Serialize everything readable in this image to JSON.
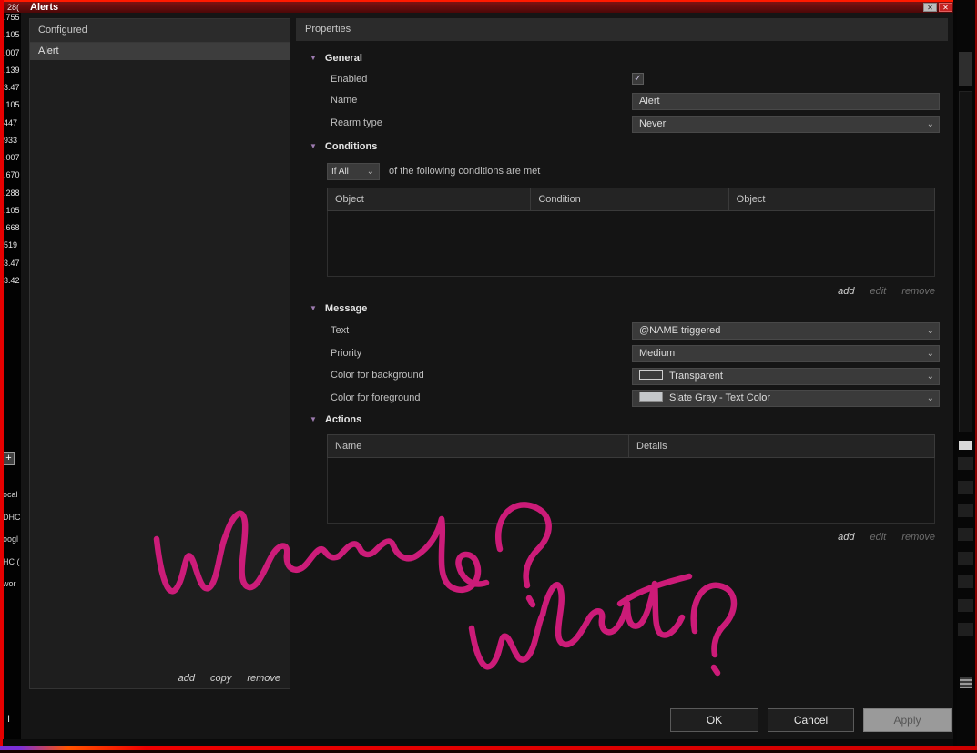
{
  "window": {
    "title": "Alerts",
    "titlebar_prefix": "28("
  },
  "icons": {
    "close": "✕",
    "check": "✓",
    "chevron_down": "⌄",
    "section_arrow": "▼",
    "plus": "+",
    "cursor": "I"
  },
  "left_axis": {
    "values": [
      ".755",
      ".105",
      ".007",
      ".139",
      "3.47",
      ".105",
      "447",
      "933",
      ".007",
      ".670",
      ".288",
      ".105",
      ".668",
      "519",
      "3.47",
      "3.42"
    ],
    "partials": [
      "ocal",
      "DHC",
      "oogl",
      "HC (",
      "wor"
    ]
  },
  "configured_panel": {
    "header": "Configured",
    "items": [
      {
        "label": "Alert",
        "selected": true
      }
    ],
    "links": {
      "add": "add",
      "copy": "copy",
      "remove": "remove"
    }
  },
  "properties_panel": {
    "header": "Properties"
  },
  "general": {
    "title": "General",
    "enabled_label": "Enabled",
    "enabled_checked": true,
    "name_label": "Name",
    "name_value": "Alert",
    "rearm_label": "Rearm type",
    "rearm_value": "Never"
  },
  "conditions": {
    "title": "Conditions",
    "match_value": "If All",
    "match_text": "of the following conditions are met",
    "headers": [
      "Object",
      "Condition",
      "Object"
    ],
    "rows": [],
    "links": {
      "add": "add",
      "edit": "edit",
      "remove": "remove"
    }
  },
  "message": {
    "title": "Message",
    "text_label": "Text",
    "text_value": "@NAME triggered",
    "priority_label": "Priority",
    "priority_value": "Medium",
    "bg_label": "Color for background",
    "bg_value": "Transparent",
    "fg_label": "Color for foreground",
    "fg_value": "Slate Gray - Text Color"
  },
  "actions": {
    "title": "Actions",
    "headers": [
      "Name",
      "Details"
    ],
    "rows": [],
    "links": {
      "add": "add",
      "edit": "edit",
      "remove": "remove"
    }
  },
  "footer": {
    "ok": "OK",
    "cancel": "Cancel",
    "apply": "Apply"
  },
  "annotation": {
    "text": "where? what?"
  },
  "colors": {
    "frame_red": "#e60000",
    "titlebar_red": "#7d1212",
    "scribble_pink": "#d61c7e",
    "fg_swatch_gray": "#c4c7ca",
    "selection_gray": "#3d3d3d"
  }
}
